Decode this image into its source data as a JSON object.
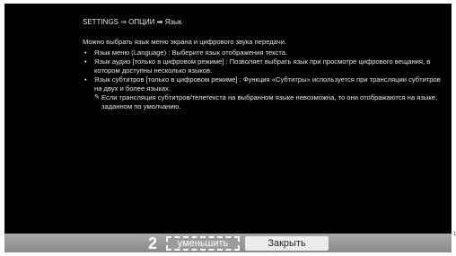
{
  "header": {
    "breadcrumb": "SETTINGS ⇒ ОПЦИИ ➡ Язык"
  },
  "main": {
    "intro": "Можно выбрать язык меню экрана и цифрового звука передачи.",
    "bullets": [
      "Язык меню (Language) : Выберите язык отображения текста.",
      "Язык аудио [только в цифровом режиме] : Позволяет выбрать язык при просмотре цифрового вещания, в котором доступны несколько языков.",
      "Язык субтитров [только в цифровом режиме] : Функция «Субтитры» используется при трансляции субтитров на двух и более языках."
    ],
    "note": "Если трансляция субтитров/телетекста на выбранном языке невозможна, то они отображаются на языке, заданном по умолчанию."
  },
  "footer": {
    "step": "2",
    "reduce_label": "уменьшить",
    "close_label": "Закрыть"
  },
  "page_marker": "1",
  "icons": {
    "bullet": "•",
    "note": "✎"
  }
}
